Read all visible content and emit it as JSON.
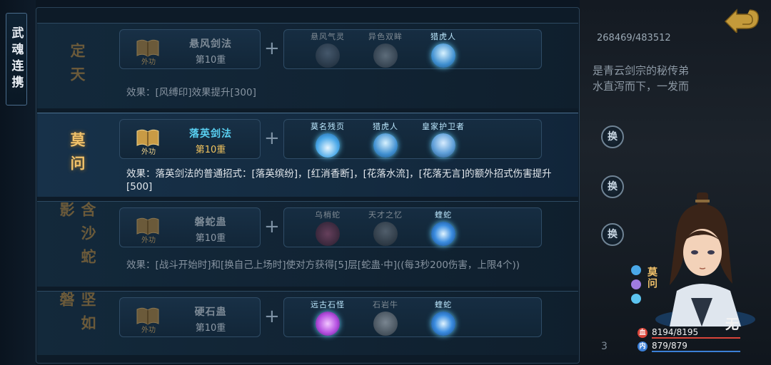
{
  "side_tab": {
    "label": "武魂连携"
  },
  "rows": [
    {
      "title": "定天",
      "active": false,
      "skill": {
        "icon_label": "外功",
        "name": "悬风剑法",
        "level": "第10重"
      },
      "combo": [
        {
          "label": "悬风气灵",
          "icon": "wind-spirit-icon",
          "on": false
        },
        {
          "label": "异色双眸",
          "icon": "eye-icon",
          "on": false
        },
        {
          "label": "猎虎人",
          "icon": "tiger-hunter-icon",
          "on": true
        }
      ],
      "effect": "效果：[风缚印]效果提升[300]"
    },
    {
      "title": "莫问",
      "active": true,
      "skill": {
        "icon_label": "外功",
        "name": "落英剑法",
        "level": "第10重"
      },
      "combo": [
        {
          "label": "莫名残页",
          "icon": "flame-icon",
          "on": true
        },
        {
          "label": "猎虎人",
          "icon": "tiger-hunter-icon",
          "on": true
        },
        {
          "label": "皇家护卫者",
          "icon": "helmet-icon",
          "on": true
        }
      ],
      "effect": "效果：落英剑法的普通招式：[落英缤纷]，[红消香断]，[花落水流]，[花落无言]的额外招式伤害提升[500]"
    },
    {
      "title": "含沙蛇影",
      "active": false,
      "skill": {
        "icon_label": "外功",
        "name": "磐蛇蛊",
        "level": "第10重"
      },
      "combo": [
        {
          "label": "乌梢蛇",
          "icon": "black-snake-icon",
          "on": false
        },
        {
          "label": "天才之忆",
          "icon": "meditator-icon",
          "on": false
        },
        {
          "label": "蝰蛇",
          "icon": "viper-icon",
          "on": true
        }
      ],
      "effect": "效果：[战斗开始时]和[换自己上场时]使对方获得[5]层[蛇蛊·中]((每3秒200伤害，上限4个))"
    },
    {
      "title": "坚如磐",
      "active": false,
      "skill": {
        "icon_label": "外功",
        "name": "硬石蛊",
        "level": "第10重"
      },
      "combo": [
        {
          "label": "远古石怪",
          "icon": "crystal-icon",
          "on": true
        },
        {
          "label": "石岩牛",
          "icon": "bull-icon",
          "on": false
        },
        {
          "label": "蝰蛇",
          "icon": "viper-icon",
          "on": true
        }
      ],
      "effect": ""
    }
  ],
  "hud": {
    "progress": "268469/483512",
    "story_text": "是青云剑宗的秘传弟\n水直泻而下，一发而",
    "swap_label": "换",
    "char_name": "莫问",
    "char_title": "无",
    "hp": "8194/8195",
    "hp_badge": "血",
    "hp_fraction": 0.999,
    "mp": "879/879",
    "mp_badge": "内",
    "mp_fraction": 1.0,
    "page_num": "3",
    "colors": {
      "hp": "#d9453a",
      "mp": "#3b7fd6",
      "accent": "#f0c16a",
      "skill_name_active": "#59d0f2"
    }
  }
}
